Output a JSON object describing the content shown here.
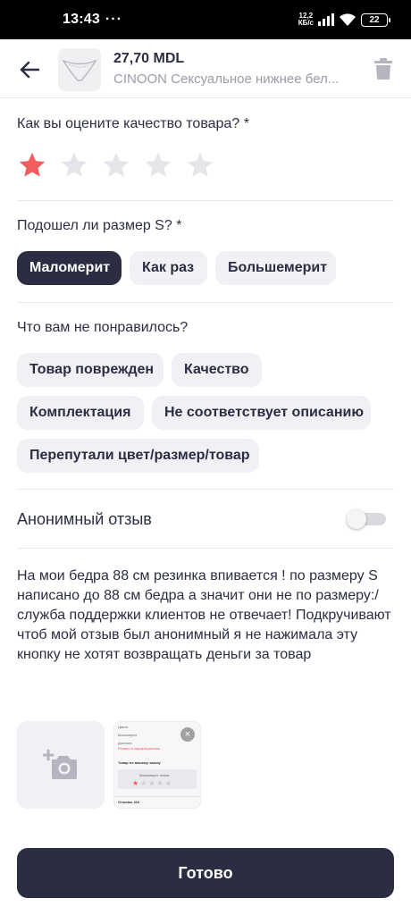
{
  "status_bar": {
    "time": "13:43",
    "dots": "···",
    "net_speed_value": "12,2",
    "net_speed_unit": "КБ/с",
    "battery": "22"
  },
  "header": {
    "price": "27,70 MDL",
    "product_name": "CINOON Сексуальное нижнее бел..."
  },
  "rating": {
    "question": "Как вы оцените качество товара? *",
    "value": 1,
    "max": 5,
    "active_color": "#f25c5c",
    "inactive_color": "#e4e4ea"
  },
  "size": {
    "question": "Подошел ли размер S? *",
    "options": [
      "Маломерит",
      "Как раз",
      "Большемерит"
    ],
    "selected": "Маломерит"
  },
  "dislikes": {
    "question": "Что вам не понравилось?",
    "options": [
      "Товар поврежден",
      "Качество",
      "Комплектация",
      "Не соответствует описанию",
      "Перепутали цвет/размер/товар"
    ]
  },
  "anonymous": {
    "label": "Анонимный отзыв",
    "enabled": false
  },
  "review": {
    "text": "На мои бедра 88 см резинка впивается ! по размеру S написано до 88 см бедра а значит они не по размеру:/ служба поддержки клиентов не отвечает! Подкручивают чтоб мой отзыв был анонимный я не нажимала эту кнопку не хотят возвращать деньги за товар"
  },
  "photos": {
    "add_icon": "add-photo-camera-icon",
    "thumb_lines": [
      "Цвета",
      "Маломерит",
      "Доплата",
      "Размер в характеристике",
      "Товар по вашему заказу",
      "Маломерит отзыв",
      "Отзывы 416"
    ]
  },
  "footer": {
    "done_label": "Готово"
  },
  "colors": {
    "primary": "#2b2d42",
    "chip_bg": "#f1f1f5",
    "muted": "#9a9ba8"
  }
}
